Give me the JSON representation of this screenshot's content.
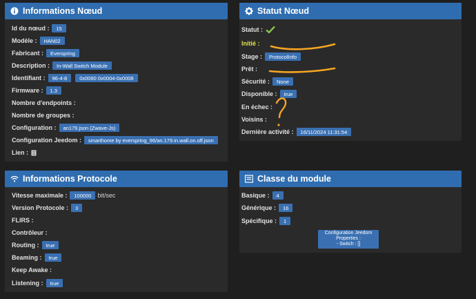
{
  "node_info": {
    "title": "Informations Nœud",
    "icon": "info-circle-icon",
    "rows": {
      "id": {
        "label": "Id du nœud :",
        "value": "15"
      },
      "model": {
        "label": "Modèle :",
        "value": "HAN02"
      },
      "maker": {
        "label": "Fabricant :",
        "value": "Everspring"
      },
      "description": {
        "label": "Description :",
        "value": "In-Wall Switch Module"
      },
      "identifier": {
        "label": "Identifiant :",
        "value1": "96-4-8",
        "value2": "0x0060 0x0004-0x0008"
      },
      "firmware": {
        "label": "Firmware :",
        "value": "1.3"
      },
      "endpoints": {
        "label": "Nombre d'endpoints :"
      },
      "groups": {
        "label": "Nombre de groupes :"
      },
      "configuration": {
        "label": "Configuration :",
        "value": "an179.json (Zwave-Js)"
      },
      "jeedom_config": {
        "label": "Configuration Jeedom :",
        "value": "smarthome by everspring_96/an.179.in.wall.on.off.json"
      },
      "link": {
        "label": "Lien :",
        "icon": "book-icon"
      }
    }
  },
  "node_status": {
    "title": "Statut Nœud",
    "icon": "gear-icon",
    "rows": {
      "status": {
        "label": "Statut :",
        "icon": "check-icon"
      },
      "initialized": {
        "label": "Initié :"
      },
      "stage": {
        "label": "Stage :",
        "value": "ProtocolInfo"
      },
      "ready": {
        "label": "Prêt :"
      },
      "security": {
        "label": "Sécurité :",
        "value": "None"
      },
      "available": {
        "label": "Disponible :",
        "value": "true"
      },
      "failed": {
        "label": "En échec :"
      },
      "neighbors": {
        "label": "Voisins :"
      },
      "last_activity": {
        "label": "Dernière activité :",
        "value": "16/11/2024 11:31:54"
      }
    }
  },
  "protocol_info": {
    "title": "Informations Protocole",
    "icon": "wifi-icon",
    "rows": {
      "max_speed": {
        "label": "Vitesse maximale :",
        "value": "100000",
        "unit": "bit/sec"
      },
      "protocol_version": {
        "label": "Version Protocole :",
        "value": "3"
      },
      "flirs": {
        "label": "FLIRS :"
      },
      "controller": {
        "label": "Contrôleur :"
      },
      "routing": {
        "label": "Routing :",
        "value": "true"
      },
      "beaming": {
        "label": "Beaming :",
        "value": "true"
      },
      "keep_awake": {
        "label": "Keep Awake :"
      },
      "listening": {
        "label": "Listening :",
        "value": "true"
      }
    }
  },
  "module_class": {
    "title": "Classe du module",
    "icon": "list-icon",
    "rows": {
      "basic": {
        "label": "Basique :",
        "value": "4"
      },
      "generic": {
        "label": "Générique :",
        "value": "16"
      },
      "specific": {
        "label": "Spécifique :",
        "value": "1"
      }
    },
    "config_box": {
      "line1": "Configuration Jeedom",
      "line2": "Properties :",
      "line3": "- Switch : []"
    }
  },
  "colors": {
    "header": "#2f6db0",
    "badge": "#3a70b2",
    "panel": "#2a2a2a",
    "background": "#1f1f1f",
    "check": "#8bc34a",
    "annotation": "#f5a623"
  }
}
